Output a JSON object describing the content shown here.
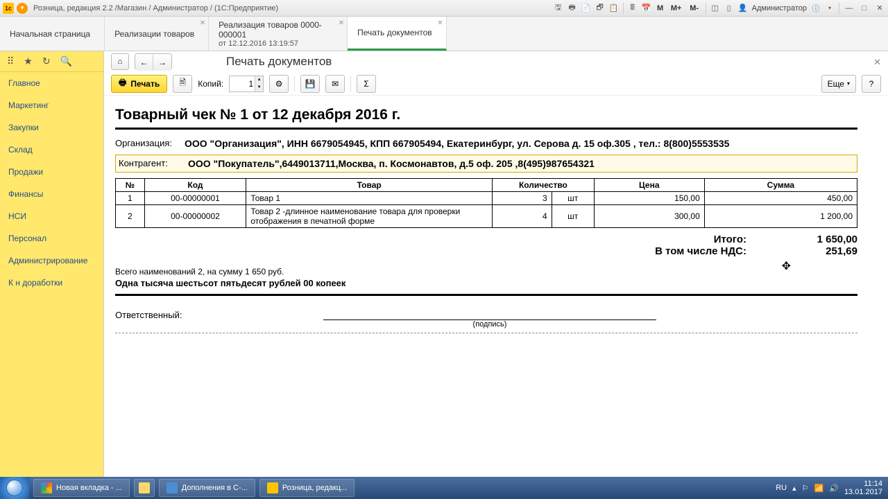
{
  "titlebar": {
    "title": "Розница, редакция 2.2 /Магазин / Администратор / (1С:Предприятие)",
    "user": "Администратор",
    "m_labels": [
      "M",
      "M+",
      "M-"
    ]
  },
  "tabs": [
    {
      "label": "Начальная страница",
      "sub": ""
    },
    {
      "label": "Реализации товаров",
      "sub": ""
    },
    {
      "label": "Реализация товаров 0000-000001",
      "sub": "от 12.12.2016 13:19:57"
    },
    {
      "label": "Печать документов",
      "sub": ""
    }
  ],
  "sidebar": {
    "items": [
      "Главное",
      "Маркетинг",
      "Закупки",
      "Склад",
      "Продажи",
      "Финансы",
      "НСИ",
      "Персонал",
      "Администрирование",
      "К н доработки"
    ]
  },
  "page": {
    "title": "Печать документов",
    "print_label": "Печать",
    "copies_label": "Копий:",
    "copies_value": "1",
    "more_label": "Еще"
  },
  "doc": {
    "title": "Товарный чек № 1 от 12 декабря 2016 г.",
    "org_label": "Организация:",
    "org_value": "ООО \"Организация\", ИНН 6679054945, КПП 667905494, Екатеринбург, ул. Серова д. 15 оф.305 , тел.: 8(800)5553535",
    "ctr_label": "Контрагент:",
    "ctr_value": "ООО \"Покупатель\",6449013711,Москва, п. Космонавтов, д.5 оф. 205 ,8(495)987654321",
    "headers": {
      "n": "№",
      "code": "Код",
      "name": "Товар",
      "qty": "Количество",
      "price": "Цена",
      "sum": "Сумма"
    },
    "items": [
      {
        "n": "1",
        "code": "00-00000001",
        "name": "Товар 1",
        "qty": "3",
        "unit": "шт",
        "price": "150,00",
        "sum": "450,00"
      },
      {
        "n": "2",
        "code": "00-00000002",
        "name": "Товар 2 -длинное наименование товара для проверки отображения в печатной форме",
        "qty": "4",
        "unit": "шт",
        "price": "300,00",
        "sum": "1 200,00"
      }
    ],
    "total_label": "Итого:",
    "total_value": "1 650,00",
    "vat_label": "В том числе НДС:",
    "vat_value": "251,69",
    "summary": "Всего наименований 2, на сумму 1 650 руб.",
    "summary_words": "Одна тысяча шестьсот пятьдесят рублей 00 копеек",
    "resp_label": "Ответственный:",
    "sign_hint": "(подпись)"
  },
  "taskbar": {
    "items": [
      "Новая вкладка - ...",
      "",
      "Дополнения в С-...",
      "Розница, редакц..."
    ],
    "lang": "RU",
    "time": "11:14",
    "date": "13.01.2017"
  }
}
